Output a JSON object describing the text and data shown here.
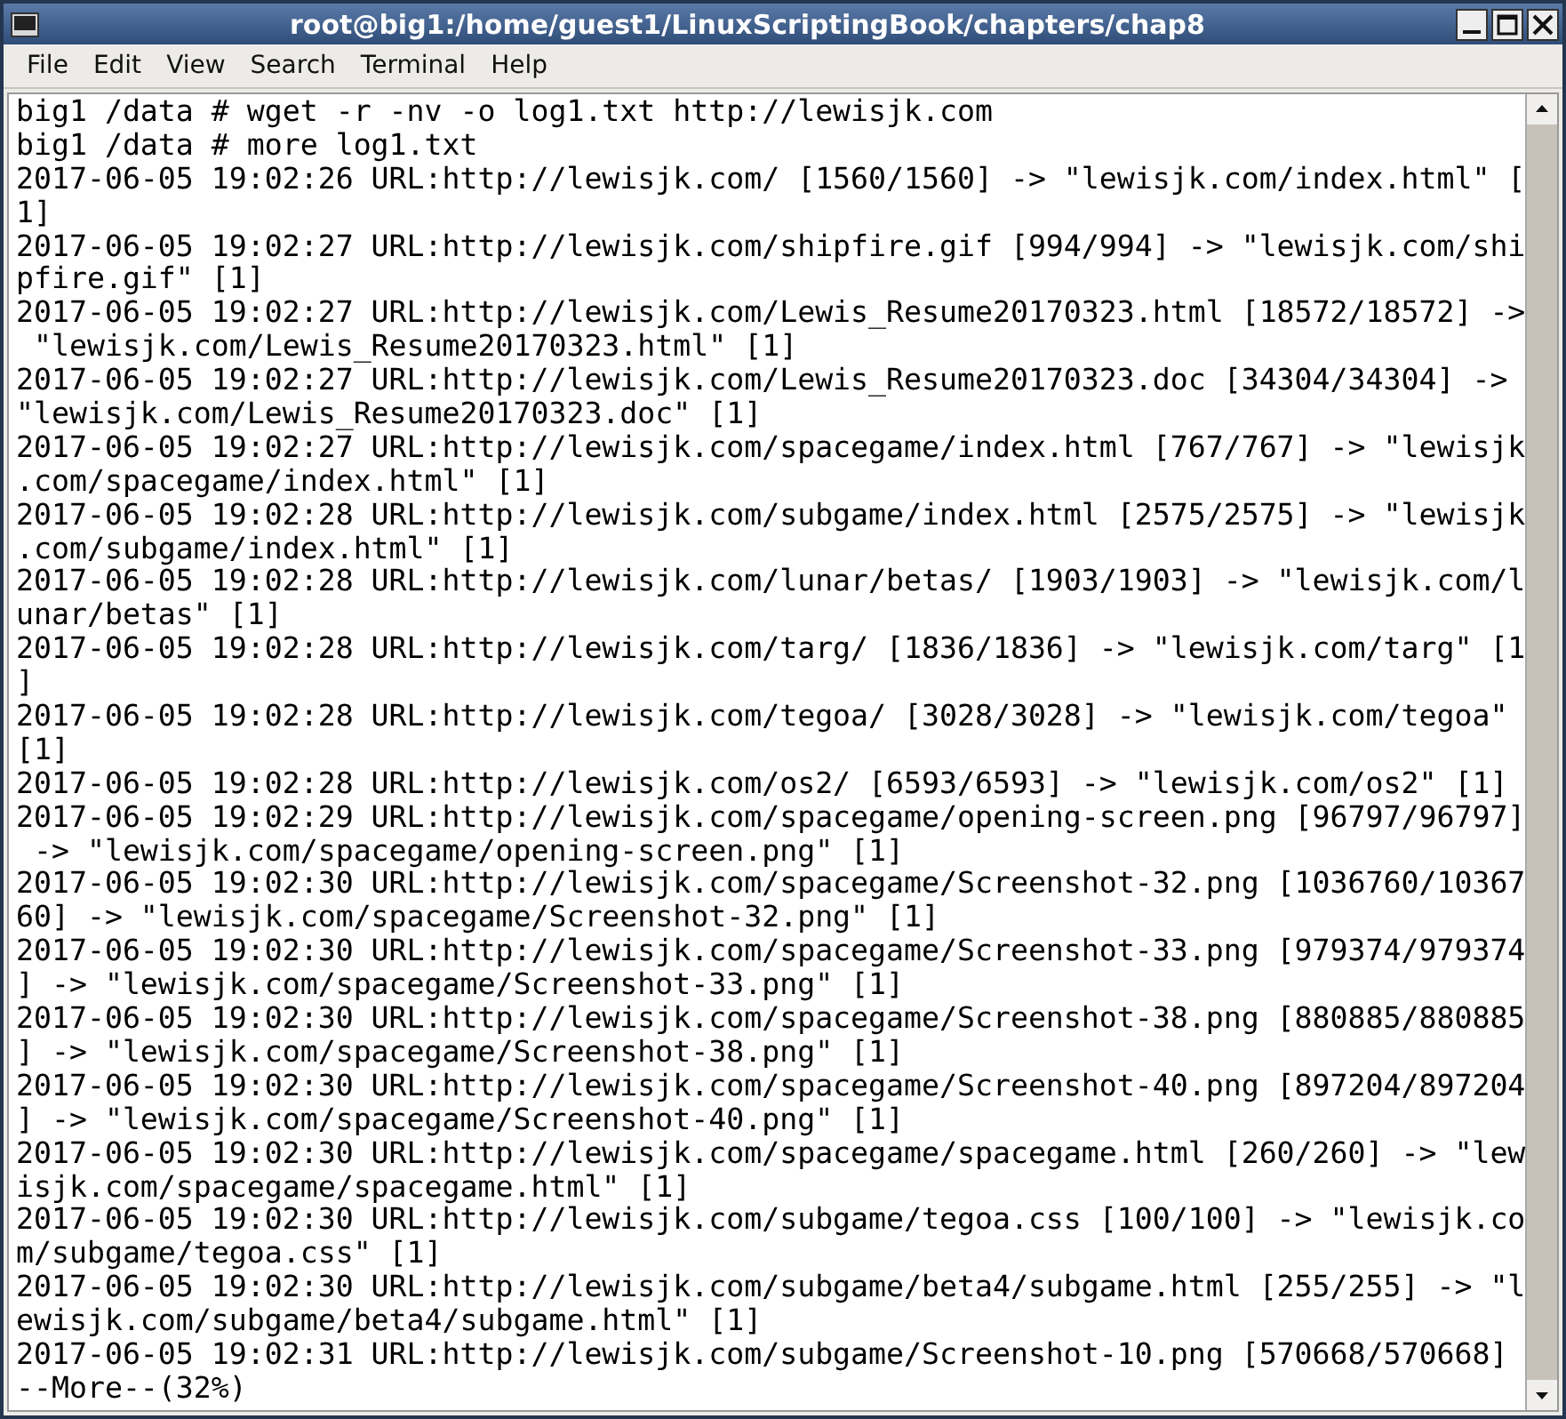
{
  "window": {
    "title": "root@big1:/home/guest1/LinuxScriptingBook/chapters/chap8"
  },
  "menu": [
    "File",
    "Edit",
    "View",
    "Search",
    "Terminal",
    "Help"
  ],
  "terminal": {
    "lines": [
      "big1 /data # wget -r -nv -o log1.txt http://lewisjk.com",
      "big1 /data # more log1.txt",
      "2017-06-05 19:02:26 URL:http://lewisjk.com/ [1560/1560] -> \"lewisjk.com/index.html\" [",
      "1]",
      "2017-06-05 19:02:27 URL:http://lewisjk.com/shipfire.gif [994/994] -> \"lewisjk.com/shi",
      "pfire.gif\" [1]",
      "2017-06-05 19:02:27 URL:http://lewisjk.com/Lewis_Resume20170323.html [18572/18572] ->",
      " \"lewisjk.com/Lewis_Resume20170323.html\" [1]",
      "2017-06-05 19:02:27 URL:http://lewisjk.com/Lewis_Resume20170323.doc [34304/34304] ->",
      "\"lewisjk.com/Lewis_Resume20170323.doc\" [1]",
      "2017-06-05 19:02:27 URL:http://lewisjk.com/spacegame/index.html [767/767] -> \"lewisjk",
      ".com/spacegame/index.html\" [1]",
      "2017-06-05 19:02:28 URL:http://lewisjk.com/subgame/index.html [2575/2575] -> \"lewisjk",
      ".com/subgame/index.html\" [1]",
      "2017-06-05 19:02:28 URL:http://lewisjk.com/lunar/betas/ [1903/1903] -> \"lewisjk.com/l",
      "unar/betas\" [1]",
      "2017-06-05 19:02:28 URL:http://lewisjk.com/targ/ [1836/1836] -> \"lewisjk.com/targ\" [1",
      "]",
      "2017-06-05 19:02:28 URL:http://lewisjk.com/tegoa/ [3028/3028] -> \"lewisjk.com/tegoa\"",
      "[1]",
      "2017-06-05 19:02:28 URL:http://lewisjk.com/os2/ [6593/6593] -> \"lewisjk.com/os2\" [1]",
      "2017-06-05 19:02:29 URL:http://lewisjk.com/spacegame/opening-screen.png [96797/96797]",
      " -> \"lewisjk.com/spacegame/opening-screen.png\" [1]",
      "2017-06-05 19:02:30 URL:http://lewisjk.com/spacegame/Screenshot-32.png [1036760/10367",
      "60] -> \"lewisjk.com/spacegame/Screenshot-32.png\" [1]",
      "2017-06-05 19:02:30 URL:http://lewisjk.com/spacegame/Screenshot-33.png [979374/979374",
      "] -> \"lewisjk.com/spacegame/Screenshot-33.png\" [1]",
      "2017-06-05 19:02:30 URL:http://lewisjk.com/spacegame/Screenshot-38.png [880885/880885",
      "] -> \"lewisjk.com/spacegame/Screenshot-38.png\" [1]",
      "2017-06-05 19:02:30 URL:http://lewisjk.com/spacegame/Screenshot-40.png [897204/897204",
      "] -> \"lewisjk.com/spacegame/Screenshot-40.png\" [1]",
      "2017-06-05 19:02:30 URL:http://lewisjk.com/spacegame/spacegame.html [260/260] -> \"lew",
      "isjk.com/spacegame/spacegame.html\" [1]",
      "2017-06-05 19:02:30 URL:http://lewisjk.com/subgame/tegoa.css [100/100] -> \"lewisjk.co",
      "m/subgame/tegoa.css\" [1]",
      "2017-06-05 19:02:30 URL:http://lewisjk.com/subgame/beta4/subgame.html [255/255] -> \"l",
      "ewisjk.com/subgame/beta4/subgame.html\" [1]",
      "2017-06-05 19:02:31 URL:http://lewisjk.com/subgame/Screenshot-10.png [570668/570668]",
      "--More--(32%)"
    ]
  }
}
